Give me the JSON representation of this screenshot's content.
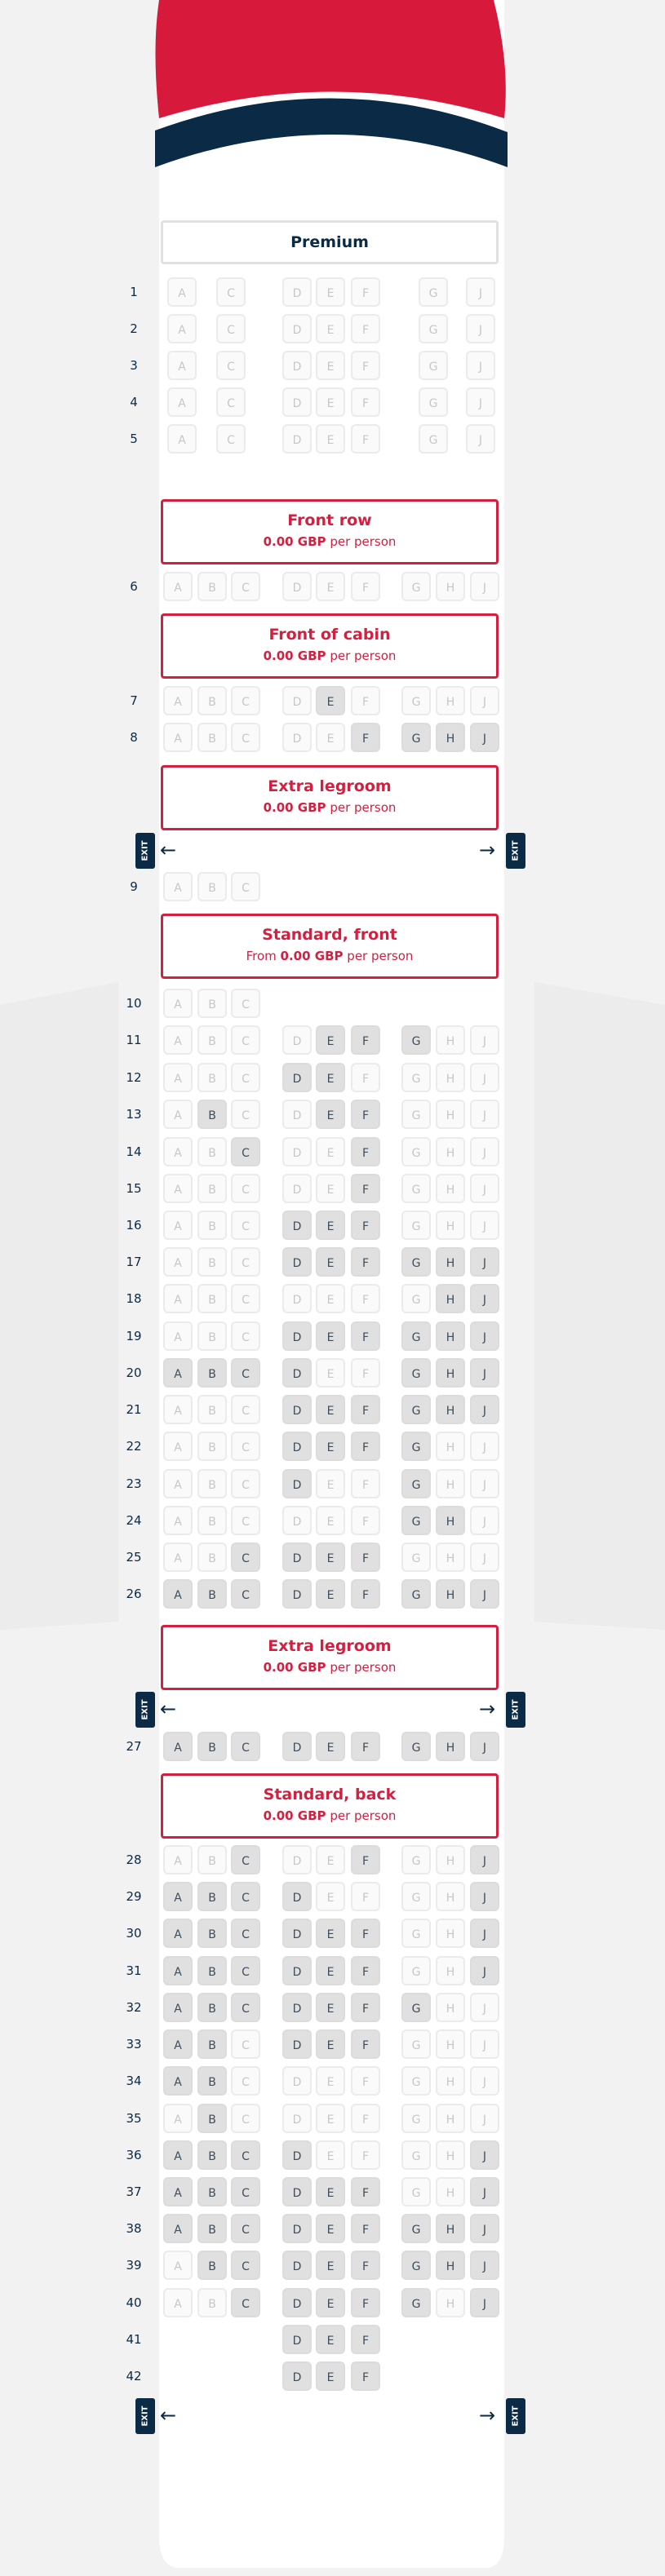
{
  "colors": {
    "accent": "#d42040",
    "navy": "#0a2a45",
    "seat_available": "#e0e0e0",
    "seat_unavailable": "#fafafa"
  },
  "exit_label": "EXIT",
  "arrow_left": "←",
  "arrow_right": "→",
  "sections": [
    {
      "id": "premium",
      "title": "Premium",
      "style": "plain"
    },
    {
      "id": "front-row",
      "title": "Front row",
      "price": "0.00 GBP",
      "suffix": "per person"
    },
    {
      "id": "front-cabin",
      "title": "Front of cabin",
      "price": "0.00 GBP",
      "suffix": "per person"
    },
    {
      "id": "extra-legroom-1",
      "title": "Extra legroom",
      "price": "0.00 GBP",
      "suffix": "per person"
    },
    {
      "id": "standard-front",
      "title": "Standard, front",
      "prefix": "From",
      "price": "0.00 GBP",
      "suffix": "per person"
    },
    {
      "id": "extra-legroom-2",
      "title": "Extra legroom",
      "price": "0.00 GBP",
      "suffix": "per person"
    },
    {
      "id": "standard-back",
      "title": "Standard, back",
      "price": "0.00 GBP",
      "suffix": "per person"
    }
  ],
  "rows": [
    {
      "num": "1",
      "seats": [
        "A.u",
        "C.u",
        "D.u",
        "E.u",
        "F.u",
        "G.u",
        "J.u"
      ]
    },
    {
      "num": "2",
      "seats": [
        "A.u",
        "C.u",
        "D.u",
        "E.u",
        "F.u",
        "G.u",
        "J.u"
      ]
    },
    {
      "num": "3",
      "seats": [
        "A.u",
        "C.u",
        "D.u",
        "E.u",
        "F.u",
        "G.u",
        "J.u"
      ]
    },
    {
      "num": "4",
      "seats": [
        "A.u",
        "C.u",
        "D.u",
        "E.u",
        "F.u",
        "G.u",
        "J.u"
      ]
    },
    {
      "num": "5",
      "seats": [
        "A.u",
        "C.u",
        "D.u",
        "E.u",
        "F.u",
        "G.u",
        "J.u"
      ]
    },
    {
      "num": "6",
      "seats": [
        "A.u",
        "B.u",
        "C.u",
        "D.u",
        "E.u",
        "F.u",
        "G.u",
        "H.u",
        "J.u"
      ]
    },
    {
      "num": "7",
      "seats": [
        "A.u",
        "B.u",
        "C.u",
        "D.u",
        "E.a",
        "F.u",
        "G.u",
        "H.u",
        "J.u"
      ]
    },
    {
      "num": "8",
      "seats": [
        "A.u",
        "B.u",
        "C.u",
        "D.u",
        "E.u",
        "F.a",
        "G.a",
        "H.a",
        "J.a"
      ]
    },
    {
      "num": "9",
      "seats": [
        "A.u",
        "B.u",
        "C.u"
      ]
    },
    {
      "num": "10",
      "seats": [
        "A.u",
        "B.u",
        "C.u"
      ]
    },
    {
      "num": "11",
      "seats": [
        "A.u",
        "B.u",
        "C.u",
        "D.u",
        "E.a",
        "F.a",
        "G.a",
        "H.u",
        "J.u"
      ]
    },
    {
      "num": "12",
      "seats": [
        "A.u",
        "B.u",
        "C.u",
        "D.a",
        "E.a",
        "F.u",
        "G.u",
        "H.u",
        "J.u"
      ]
    },
    {
      "num": "13",
      "seats": [
        "A.u",
        "B.a",
        "C.u",
        "D.u",
        "E.a",
        "F.a",
        "G.u",
        "H.u",
        "J.u"
      ]
    },
    {
      "num": "14",
      "seats": [
        "A.u",
        "B.u",
        "C.a",
        "D.u",
        "E.u",
        "F.a",
        "G.u",
        "H.u",
        "J.u"
      ]
    },
    {
      "num": "15",
      "seats": [
        "A.u",
        "B.u",
        "C.u",
        "D.u",
        "E.u",
        "F.a",
        "G.u",
        "H.u",
        "J.u"
      ]
    },
    {
      "num": "16",
      "seats": [
        "A.u",
        "B.u",
        "C.u",
        "D.a",
        "E.a",
        "F.a",
        "G.u",
        "H.u",
        "J.u"
      ]
    },
    {
      "num": "17",
      "seats": [
        "A.u",
        "B.u",
        "C.u",
        "D.a",
        "E.a",
        "F.a",
        "G.a",
        "H.a",
        "J.a"
      ]
    },
    {
      "num": "18",
      "seats": [
        "A.u",
        "B.u",
        "C.u",
        "D.u",
        "E.u",
        "F.u",
        "G.u",
        "H.a",
        "J.a"
      ]
    },
    {
      "num": "19",
      "seats": [
        "A.u",
        "B.u",
        "C.u",
        "D.a",
        "E.a",
        "F.a",
        "G.a",
        "H.a",
        "J.a"
      ]
    },
    {
      "num": "20",
      "seats": [
        "A.a",
        "B.a",
        "C.a",
        "D.a",
        "E.u",
        "F.u",
        "G.a",
        "H.a",
        "J.a"
      ]
    },
    {
      "num": "21",
      "seats": [
        "A.u",
        "B.u",
        "C.u",
        "D.a",
        "E.a",
        "F.a",
        "G.a",
        "H.a",
        "J.a"
      ]
    },
    {
      "num": "22",
      "seats": [
        "A.u",
        "B.u",
        "C.u",
        "D.a",
        "E.a",
        "F.a",
        "G.a",
        "H.u",
        "J.u"
      ]
    },
    {
      "num": "23",
      "seats": [
        "A.u",
        "B.u",
        "C.u",
        "D.a",
        "E.u",
        "F.u",
        "G.a",
        "H.u",
        "J.u"
      ]
    },
    {
      "num": "24",
      "seats": [
        "A.u",
        "B.u",
        "C.u",
        "D.u",
        "E.u",
        "F.u",
        "G.a",
        "H.a",
        "J.u"
      ]
    },
    {
      "num": "25",
      "seats": [
        "A.u",
        "B.u",
        "C.a",
        "D.a",
        "E.a",
        "F.a",
        "G.u",
        "H.u",
        "J.u"
      ]
    },
    {
      "num": "26",
      "seats": [
        "A.a",
        "B.a",
        "C.a",
        "D.a",
        "E.a",
        "F.a",
        "G.a",
        "H.a",
        "J.a"
      ]
    },
    {
      "num": "27",
      "seats": [
        "A.a",
        "B.a",
        "C.a",
        "D.a",
        "E.a",
        "F.a",
        "G.a",
        "H.a",
        "J.a"
      ]
    },
    {
      "num": "28",
      "seats": [
        "A.u",
        "B.u",
        "C.a",
        "D.u",
        "E.u",
        "F.a",
        "G.u",
        "H.u",
        "J.a"
      ]
    },
    {
      "num": "29",
      "seats": [
        "A.a",
        "B.a",
        "C.a",
        "D.a",
        "E.u",
        "F.u",
        "G.u",
        "H.u",
        "J.a"
      ]
    },
    {
      "num": "30",
      "seats": [
        "A.a",
        "B.a",
        "C.a",
        "D.a",
        "E.a",
        "F.a",
        "G.u",
        "H.u",
        "J.a"
      ]
    },
    {
      "num": "31",
      "seats": [
        "A.a",
        "B.a",
        "C.a",
        "D.a",
        "E.a",
        "F.a",
        "G.u",
        "H.u",
        "J.a"
      ]
    },
    {
      "num": "32",
      "seats": [
        "A.a",
        "B.a",
        "C.a",
        "D.a",
        "E.a",
        "F.a",
        "G.a",
        "H.u",
        "J.u"
      ]
    },
    {
      "num": "33",
      "seats": [
        "A.a",
        "B.a",
        "C.u",
        "D.a",
        "E.a",
        "F.a",
        "G.u",
        "H.u",
        "J.u"
      ]
    },
    {
      "num": "34",
      "seats": [
        "A.a",
        "B.a",
        "C.u",
        "D.u",
        "E.u",
        "F.u",
        "G.u",
        "H.u",
        "J.u"
      ]
    },
    {
      "num": "35",
      "seats": [
        "A.u",
        "B.a",
        "C.u",
        "D.u",
        "E.u",
        "F.u",
        "G.u",
        "H.u",
        "J.u"
      ]
    },
    {
      "num": "36",
      "seats": [
        "A.a",
        "B.a",
        "C.a",
        "D.a",
        "E.u",
        "F.u",
        "G.u",
        "H.u",
        "J.a"
      ]
    },
    {
      "num": "37",
      "seats": [
        "A.a",
        "B.a",
        "C.a",
        "D.a",
        "E.a",
        "F.a",
        "G.u",
        "H.u",
        "J.a"
      ]
    },
    {
      "num": "38",
      "seats": [
        "A.a",
        "B.a",
        "C.a",
        "D.a",
        "E.a",
        "F.a",
        "G.a",
        "H.a",
        "J.a"
      ]
    },
    {
      "num": "39",
      "seats": [
        "A.u",
        "B.a",
        "C.a",
        "D.a",
        "E.a",
        "F.a",
        "G.a",
        "H.a",
        "J.a"
      ]
    },
    {
      "num": "40",
      "seats": [
        "A.u",
        "B.u",
        "C.a",
        "D.a",
        "E.a",
        "F.a",
        "G.a",
        "H.u",
        "J.a"
      ]
    },
    {
      "num": "41",
      "seats": [
        "D.a",
        "E.a",
        "F.a"
      ]
    },
    {
      "num": "42",
      "seats": [
        "D.a",
        "E.a",
        "F.a"
      ]
    }
  ]
}
